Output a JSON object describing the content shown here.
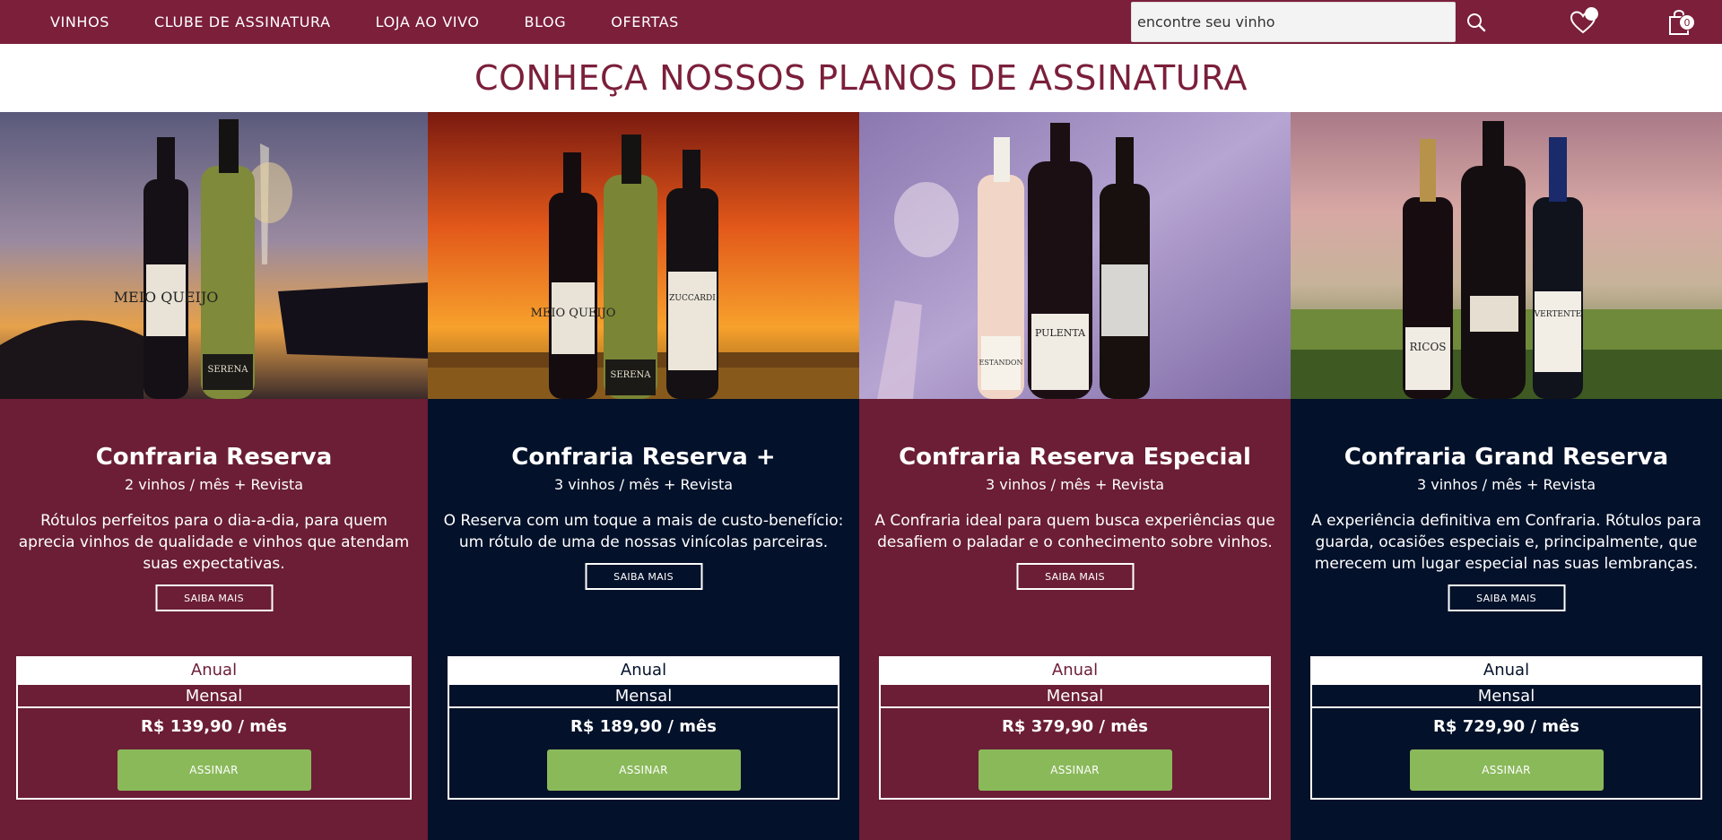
{
  "nav": {
    "items": [
      "VINHOS",
      "CLUBE DE ASSINATURA",
      "LOJA AO VIVO",
      "BLOG",
      "OFERTAS"
    ],
    "search_placeholder": "encontre seu vinho",
    "icons": {
      "search": "search-icon",
      "wishlist": "heart-icon",
      "cart": "shopping-bag-icon"
    },
    "cart_count": "0",
    "colors": {
      "bar": "#7b1f3b"
    }
  },
  "page": {
    "heading": "CONHEÇA NOSSOS PLANOS DE ASSINATURA"
  },
  "plans": [
    {
      "title": "Confraria Reserva",
      "subtitle": "2 vinhos / mês + Revista",
      "description": "Rótulos perfeitos para o dia-a-dia, para quem aprecia vinhos de qualidade e vinhos que atendam suas expectativas.",
      "more_label": "SAIBA MAIS",
      "anual_label": "Anual",
      "mensal_label": "Mensal",
      "price": "R$ 139,90 / mês",
      "cta_label": "ASSINAR",
      "theme": "wine",
      "bottle_labels": [
        "MEIO QUEIJO",
        "SERENA"
      ]
    },
    {
      "title": "Confraria Reserva +",
      "subtitle": "3 vinhos / mês + Revista",
      "description": "O Reserva com um toque a mais de custo-benefício: um rótulo de uma de nossas vinícolas parceiras.",
      "more_label": "SAIBA MAIS",
      "anual_label": "Anual",
      "mensal_label": "Mensal",
      "price": "R$ 189,90 / mês",
      "cta_label": "ASSINAR",
      "theme": "navy",
      "bottle_labels": [
        "MEIO QUEIJO",
        "SERENA",
        "ZUCCARDI"
      ]
    },
    {
      "title": "Confraria Reserva Especial",
      "subtitle": "3 vinhos / mês + Revista",
      "description": "A Confraria ideal para quem busca experiências que desafiem o paladar e o conhecimento sobre vinhos.",
      "more_label": "SAIBA MAIS",
      "anual_label": "Anual",
      "mensal_label": "Mensal",
      "price": "R$ 379,90 / mês",
      "cta_label": "ASSINAR",
      "theme": "wine",
      "bottle_labels": [
        "ESTANDON",
        "PULENTA"
      ]
    },
    {
      "title": "Confraria Grand Reserva",
      "subtitle": "3 vinhos / mês + Revista",
      "description": "A experiência definitiva em Confraria. Rótulos para guarda, ocasiões especiais e, principalmente, que merecem um lugar especial nas suas lembranças.",
      "more_label": "SAIBA MAIS",
      "anual_label": "Anual",
      "mensal_label": "Mensal",
      "price": "R$ 729,90 / mês",
      "cta_label": "ASSINAR",
      "theme": "navy",
      "bottle_labels": [
        "RICOS",
        "VERTENTE"
      ]
    }
  ],
  "colors": {
    "wine": "#6b1e36",
    "navy": "#03112a",
    "cta": "#8ab95a",
    "heading": "#7b1f3b"
  }
}
